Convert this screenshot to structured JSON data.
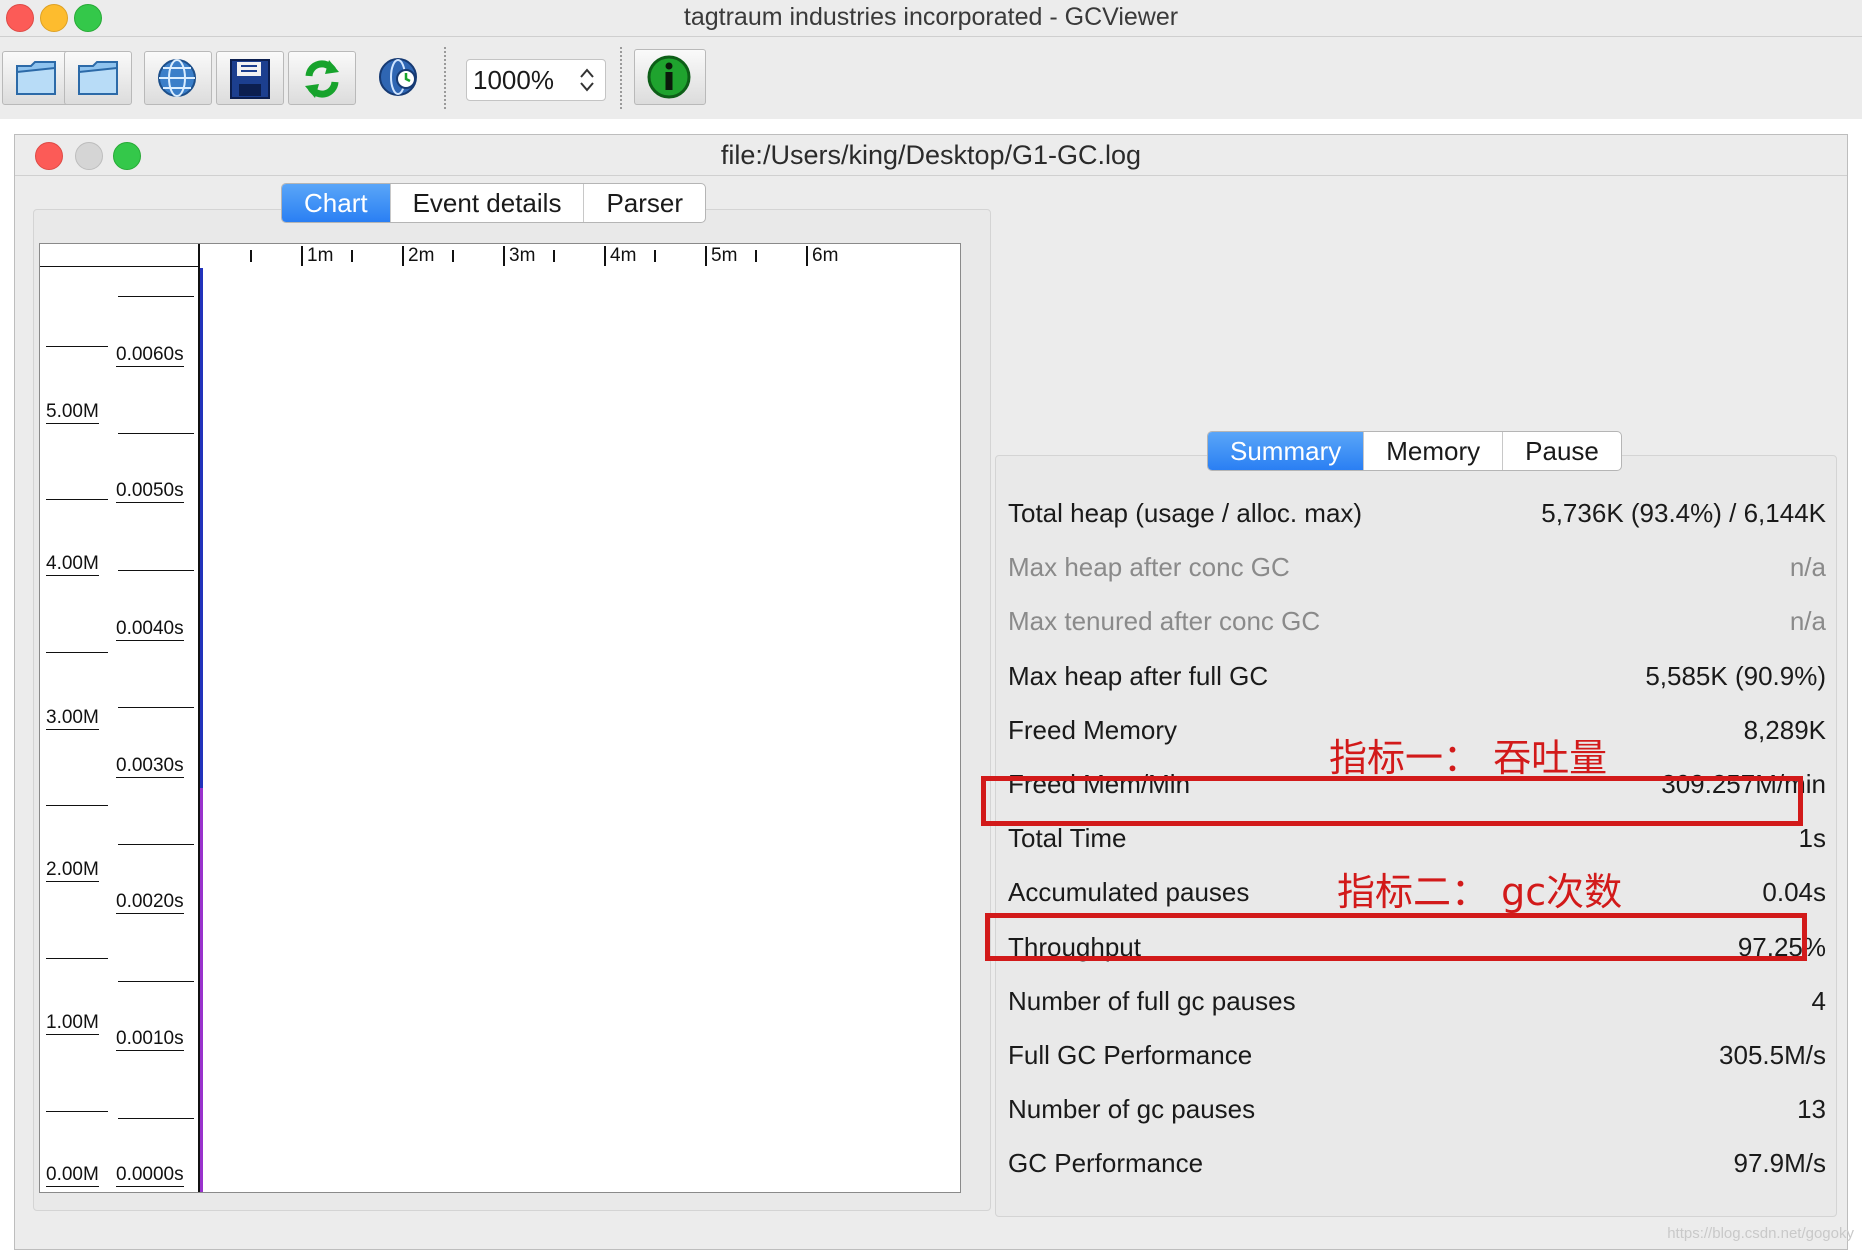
{
  "app": {
    "title": "tagtraum industries incorporated - GCViewer"
  },
  "toolbar": {
    "buttons": [
      {
        "icon": "open-file-icon"
      },
      {
        "icon": "open-folder-icon"
      },
      {
        "icon": "open-url-icon"
      },
      {
        "icon": "save-icon"
      },
      {
        "icon": "refresh-icon"
      },
      {
        "icon": "watch-icon"
      }
    ],
    "zoom_value": "1000%",
    "info_icon": "info-icon"
  },
  "document": {
    "title": "file:/Users/king/Desktop/G1-GC.log"
  },
  "chart_tabs": [
    {
      "label": "Chart",
      "active": true
    },
    {
      "label": "Event details",
      "active": false
    },
    {
      "label": "Parser",
      "active": false
    }
  ],
  "chart": {
    "time_ticks": [
      "1m",
      "2m",
      "3m",
      "4m",
      "5m",
      "6m"
    ],
    "memory_labels": [
      "5.00M",
      "4.00M",
      "3.00M",
      "2.00M",
      "1.00M",
      "0.00M"
    ],
    "pause_labels": [
      "0.0060s",
      "0.0050s",
      "0.0040s",
      "0.0030s",
      "0.0020s",
      "0.0010s",
      "0.0000s"
    ]
  },
  "summary_tabs": [
    {
      "label": "Summary",
      "active": true
    },
    {
      "label": "Memory",
      "active": false
    },
    {
      "label": "Pause",
      "active": false
    }
  ],
  "summary": [
    {
      "label": "Total heap (usage / alloc. max)",
      "value": "5,736K (93.4%) / 6,144K",
      "dim": false
    },
    {
      "label": "Max heap after conc GC",
      "value": "n/a",
      "dim": true
    },
    {
      "label": "Max tenured after conc GC",
      "value": "n/a",
      "dim": true
    },
    {
      "label": "Max heap after full GC",
      "value": "5,585K (90.9%)",
      "dim": false
    },
    {
      "label": "Freed Memory",
      "value": "8,289K",
      "dim": false
    },
    {
      "label": "Freed Mem/Min",
      "value": "309.257M/min",
      "dim": false
    },
    {
      "label": "Total Time",
      "value": "1s",
      "dim": false
    },
    {
      "label": "Accumulated pauses",
      "value": "0.04s",
      "dim": false
    },
    {
      "label": "Throughput",
      "value": "97.25%",
      "dim": false
    },
    {
      "label": "Number of full gc pauses",
      "value": "4",
      "dim": false
    },
    {
      "label": "Full GC Performance",
      "value": "305.5M/s",
      "dim": false
    },
    {
      "label": "Number of gc pauses",
      "value": "13",
      "dim": false
    },
    {
      "label": "GC Performance",
      "value": "97.9M/s",
      "dim": false
    }
  ],
  "annotations": {
    "metric1": "指标一： 吞吐量",
    "metric2": "指标二： gc次数"
  },
  "colors": {
    "highlight": "#d21a1a",
    "tab_active": "#2a7ff3"
  },
  "watermark": "https://blog.csdn.net/gogoky"
}
